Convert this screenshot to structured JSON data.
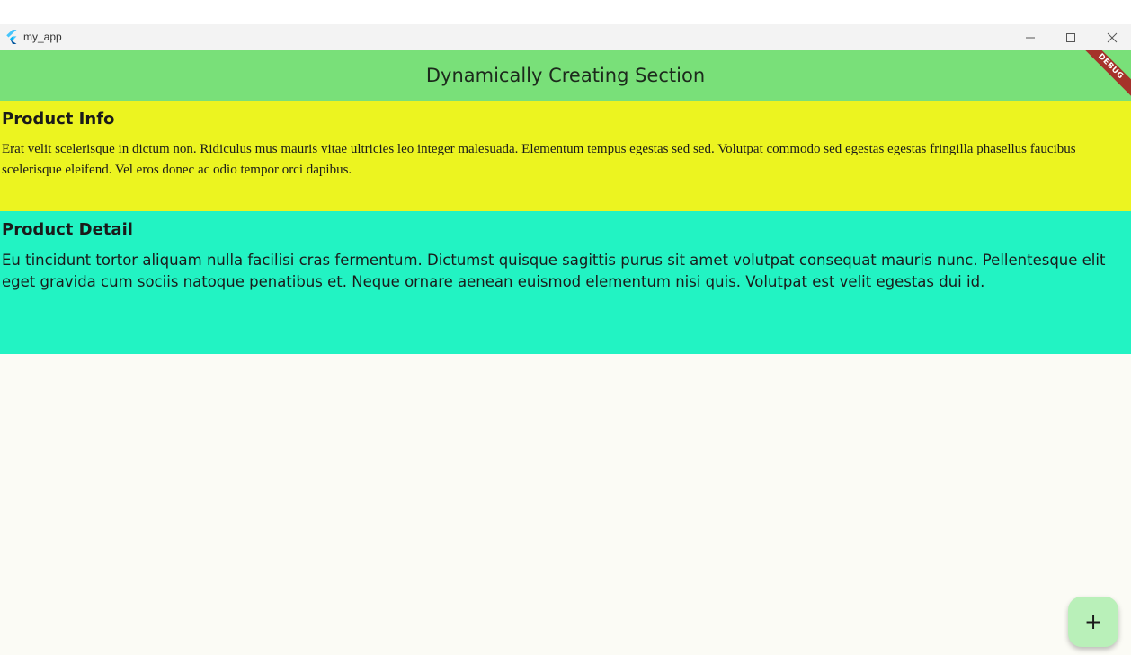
{
  "window": {
    "title": "my_app",
    "icons": {
      "app": "flutter-logo-icon",
      "minimize": "minimize-icon",
      "maximize": "maximize-icon",
      "close": "close-icon"
    }
  },
  "appbar": {
    "title": "Dynamically Creating Section",
    "background": "#79e079"
  },
  "debug_banner": {
    "label": "DEBUG",
    "color": "#a5322a"
  },
  "sections": [
    {
      "title": "Product Info",
      "body": "Erat velit scelerisque in dictum non. Ridiculus mus mauris vitae ultricies leo integer malesuada. Elementum tempus egestas sed sed. Volutpat commodo sed egestas egestas fringilla phasellus faucibus scelerisque eleifend. Vel eros donec ac odio tempor orci dapibus.",
      "background": "#ecf420"
    },
    {
      "title": "Product Detail",
      "body": "Eu tincidunt tortor aliquam nulla facilisi cras fermentum. Dictumst quisque sagittis purus sit amet volutpat consequat mauris nunc. Pellentesque elit eget gravida cum sociis natoque penatibus et. Neque ornare aenean euismod elementum nisi quis. Volutpat est velit egestas dui id.",
      "background": "#22f3c3"
    }
  ],
  "fab": {
    "icon": "plus-icon",
    "glyph": "+",
    "background": "#b9f0b9"
  }
}
